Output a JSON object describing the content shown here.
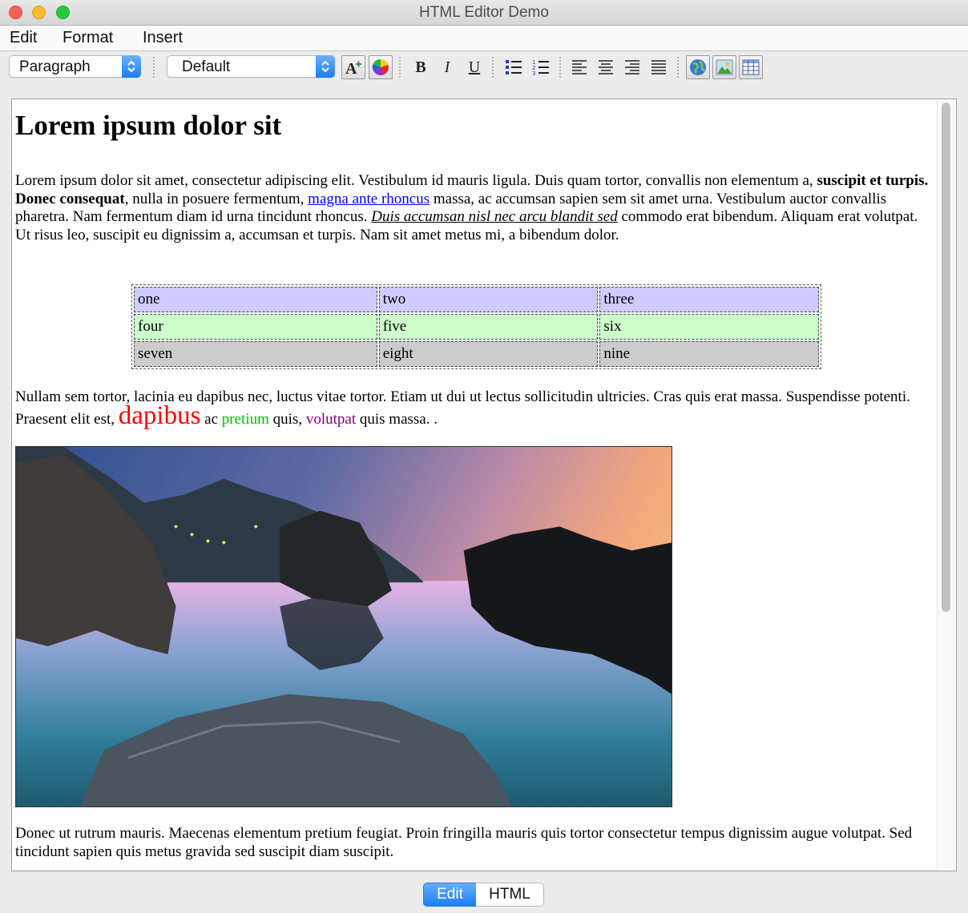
{
  "window": {
    "title": "HTML Editor Demo"
  },
  "menu": {
    "edit": "Edit",
    "format": "Format",
    "insert": "Insert"
  },
  "toolbar": {
    "paragraph_style": "Paragraph",
    "font_family": "Default",
    "icons": [
      "font-size-icon",
      "color-wheel-icon",
      "bold-icon",
      "italic-icon",
      "underline-icon",
      "bulleted-list-icon",
      "numbered-list-icon",
      "align-left-icon",
      "align-center-icon",
      "align-right-icon",
      "align-justify-icon",
      "insert-link-icon",
      "insert-image-icon",
      "insert-table-icon"
    ],
    "bold_glyph": "B",
    "italic_glyph": "I",
    "underline_glyph": "U"
  },
  "document": {
    "heading": "Lorem ipsum dolor sit",
    "p1": {
      "t1": "Lorem ipsum dolor sit amet, consectetur adipiscing elit. Vestibulum id mauris ligula. Duis quam tortor, convallis non elementum a, ",
      "bold": "suscipit et turpis. Donec consequat",
      "t2": ", nulla in posuere fermentum, ",
      "link": "magna ante rhoncus",
      "t3": " massa, ac accumsan sapien sem sit amet urna. Vestibulum auctor convallis pharetra. Nam fermentum diam id urna tincidunt rhoncus. ",
      "italic_underline": "Duis accumsan nisl nec arcu blandit sed",
      "t4": " commodo erat bibendum. Aliquam erat volutpat. Ut risus leo, suscipit eu dignissim a, accumsan et turpis. Nam sit amet metus mi, a bibendum dolor."
    },
    "table": {
      "rows": [
        {
          "cells": [
            "one",
            "two",
            "three"
          ],
          "bg": "#ccccff"
        },
        {
          "cells": [
            "four",
            "five",
            "six"
          ],
          "bg": "#ccffcc"
        },
        {
          "cells": [
            "seven",
            "eight",
            "nine"
          ],
          "bg": "#cccccc"
        }
      ]
    },
    "p2": {
      "t1": "Nullam sem tortor, lacinia eu dapibus nec, luctus vitae tortor. Etiam ut dui ut lectus sollicitudin ultricies. Cras quis erat massa. Suspendisse potenti. Praesent elit est, ",
      "big_red": "dapibus",
      "t2": " ac ",
      "green": "pretium",
      "t3": " quis, ",
      "purple": "volutpat",
      "t4": " quis massa. ."
    },
    "p3": "Donec ut rutrum mauris. Maecenas elementum pretium feugiat. Proin fringilla mauris quis tortor consectetur tempus dignissim augue volutpat. Sed tincidunt sapien quis metus gravida sed suscipit diam suscipit."
  },
  "colors": {
    "red": "#ff0000",
    "green": "#00bb00",
    "purple": "#800080",
    "link": "#0000ee",
    "accent": "#1d7ff2"
  },
  "tabs": {
    "edit": "Edit",
    "html": "HTML"
  }
}
